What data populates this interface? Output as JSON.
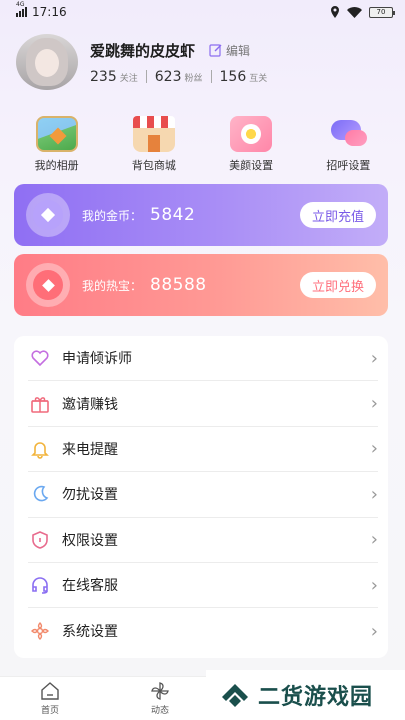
{
  "status_bar": {
    "time": "17:16",
    "network": "4G",
    "battery": "70"
  },
  "profile": {
    "name": "爱跳舞的皮皮虾",
    "edit_label": "编辑",
    "stats": [
      {
        "value": "235",
        "label": "关注"
      },
      {
        "value": "623",
        "label": "粉丝"
      },
      {
        "value": "156",
        "label": "互关"
      }
    ]
  },
  "quick_actions": [
    {
      "label": "我的相册",
      "icon": "photo-album-icon"
    },
    {
      "label": "背包商城",
      "icon": "shop-icon"
    },
    {
      "label": "美颜设置",
      "icon": "beauty-flower-icon"
    },
    {
      "label": "招呼设置",
      "icon": "chat-bubbles-icon"
    }
  ],
  "wallet": {
    "coins": {
      "label": "我的金币：",
      "value": "5842",
      "button": "立即充值"
    },
    "rewards": {
      "label": "我的热宝：",
      "value": "88588",
      "button": "立即兑换"
    }
  },
  "menu": [
    {
      "label": "申请倾诉师",
      "icon": "heart-chat-icon"
    },
    {
      "label": "邀请赚钱",
      "icon": "gift-box-icon"
    },
    {
      "label": "来电提醒",
      "icon": "bell-icon"
    },
    {
      "label": "勿扰设置",
      "icon": "moon-icon"
    },
    {
      "label": "权限设置",
      "icon": "shield-icon"
    },
    {
      "label": "在线客服",
      "icon": "headset-icon"
    },
    {
      "label": "系统设置",
      "icon": "flower-settings-icon"
    }
  ],
  "tabbar": [
    {
      "label": "首页",
      "icon": "home-icon"
    },
    {
      "label": "动态",
      "icon": "pinwheel-icon"
    }
  ],
  "watermark": {
    "text": "二货游戏园"
  },
  "colors": {
    "coin_card": "#8f6ff3",
    "reward_card": "#ff7c86",
    "accent_purple": "#7a5ae8",
    "accent_pink": "#ff6f7c"
  }
}
